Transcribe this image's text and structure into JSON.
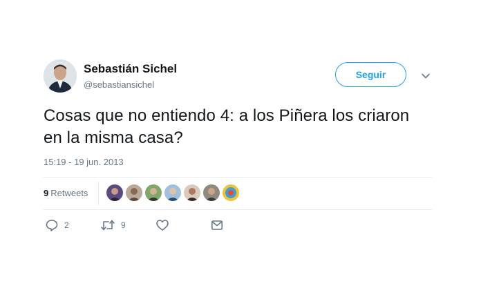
{
  "user": {
    "name": "Sebastián Sichel",
    "handle": "@sebastiansichel"
  },
  "follow_label": "Seguir",
  "tweet": {
    "text": "Cosas que no entiendo 4: a los Piñera los criaron en la misma casa?",
    "timestamp": "15:19 - 19 jun. 2013"
  },
  "stats": {
    "retweets_count": "9",
    "retweets_label": "Retweets"
  },
  "actions": {
    "replies_count": "2",
    "retweets_count": "9"
  },
  "icons": {
    "reply": "speech-bubble-icon",
    "retweet": "retweet-arrows-icon",
    "like": "heart-icon",
    "message": "envelope-icon",
    "menu": "chevron-down-icon"
  },
  "colors": {
    "accent": "#1da1f2",
    "text": "#14171a",
    "secondary": "#657786",
    "divider": "#e6ecf0"
  }
}
